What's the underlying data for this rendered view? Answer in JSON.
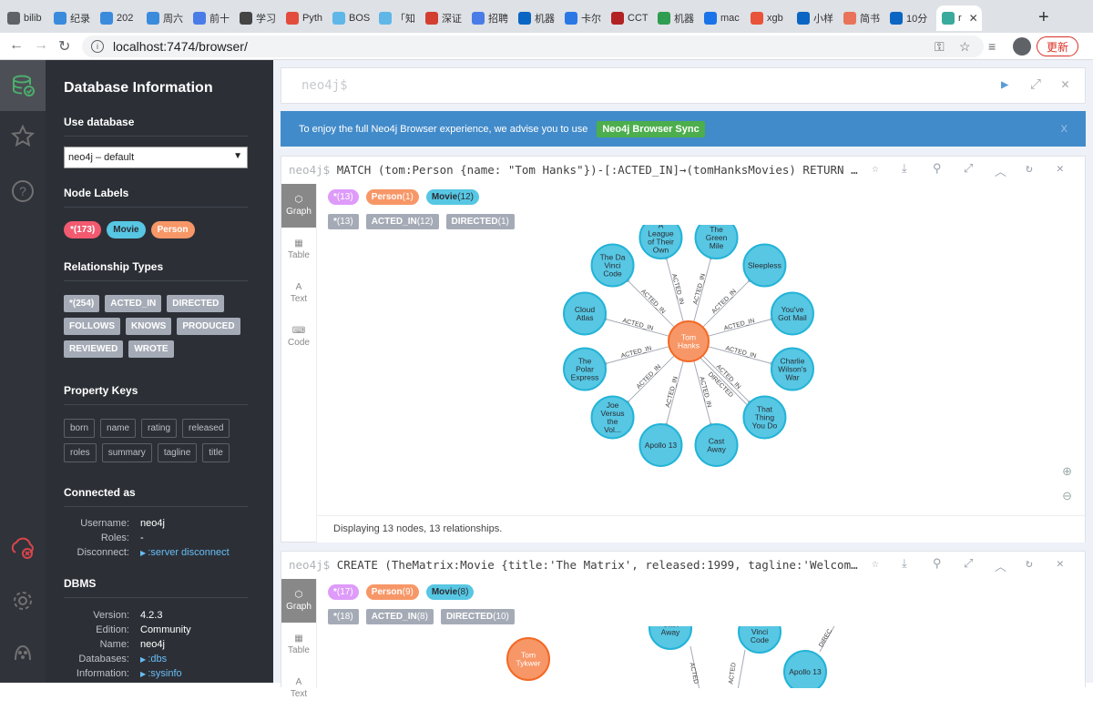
{
  "browser": {
    "tabs": [
      {
        "label": "bilib",
        "color": "#5f6368"
      },
      {
        "label": "纪录",
        "color": "#3b8bdc"
      },
      {
        "label": "202",
        "color": "#3b8bdc"
      },
      {
        "label": "周六",
        "color": "#3b8bdc"
      },
      {
        "label": "前十",
        "color": "#4a7ce8"
      },
      {
        "label": "学习",
        "color": "#444444"
      },
      {
        "label": "Pyth",
        "color": "#e34c3c"
      },
      {
        "label": "BOS",
        "color": "#5fb7e8"
      },
      {
        "label": "「知",
        "color": "#5fb7e8"
      },
      {
        "label": "深证",
        "color": "#d23f31"
      },
      {
        "label": "招聘",
        "color": "#4a7ce8"
      },
      {
        "label": "机器",
        "color": "#0a66c2"
      },
      {
        "label": "卡尔",
        "color": "#2b78e4"
      },
      {
        "label": "CCT",
        "color": "#b22222"
      },
      {
        "label": "机器",
        "color": "#2e9d4f"
      },
      {
        "label": "mac",
        "color": "#1a73e8"
      },
      {
        "label": "xgb",
        "color": "#e8533a"
      },
      {
        "label": "小样",
        "color": "#0a66c2"
      },
      {
        "label": "简书",
        "color": "#e9735a"
      },
      {
        "label": "10分",
        "color": "#0a66c2"
      },
      {
        "label": "r",
        "color": "#3aaa9c"
      }
    ],
    "url": "localhost:7474/browser/",
    "update_label": "更新"
  },
  "sidebar": {
    "title": "Database Information",
    "use_database_heading": "Use database",
    "selected_database": "neo4j – default",
    "node_labels_heading": "Node Labels",
    "node_labels": [
      {
        "label": "*(173)",
        "color": "#f25a70"
      },
      {
        "label": "Movie",
        "color": "#57c7e3"
      },
      {
        "label": "Person",
        "color": "#f79767"
      }
    ],
    "relationship_types_heading": "Relationship Types",
    "relationship_types": [
      "*(254)",
      "ACTED_IN",
      "DIRECTED",
      "FOLLOWS",
      "KNOWS",
      "PRODUCED",
      "REVIEWED",
      "WROTE"
    ],
    "property_keys_heading": "Property Keys",
    "property_keys": [
      "born",
      "name",
      "rating",
      "released",
      "roles",
      "summary",
      "tagline",
      "title"
    ],
    "connected_heading": "Connected as",
    "username_label": "Username:",
    "username": "neo4j",
    "roles_label": "Roles:",
    "roles": "-",
    "disconnect_label": "Disconnect:",
    "disconnect_link": ":server disconnect",
    "dbms_heading": "DBMS",
    "version_label": "Version:",
    "version": "4.2.3",
    "edition_label": "Edition:",
    "edition": "Community",
    "name_label": "Name:",
    "name": "neo4j",
    "databases_label": "Databases:",
    "databases_link": ":dbs",
    "information_label": "Information:",
    "information_link": ":sysinfo"
  },
  "editor": {
    "placeholder": "neo4j$"
  },
  "banner": {
    "text": "To enjoy the full Neo4j Browser experience, we advise you to use",
    "sync_label": "Neo4j Browser Sync",
    "close": "X"
  },
  "frames": [
    {
      "prompt": "neo4j$",
      "query": "MATCH (tom:Person {name: \"Tom Hanks\"})-[:ACTED_IN]→(tomHanksMovies) RETURN tom,tomHanksMovies",
      "views": [
        "Graph",
        "Table",
        "Text",
        "Code"
      ],
      "node_legend": [
        {
          "name": "*",
          "count": "(13)",
          "bg": "#de9bf9",
          "fg": "#ffffff"
        },
        {
          "name": "Person",
          "count": "(1)",
          "bg": "#f79767",
          "fg": "#ffffff"
        },
        {
          "name": "Movie",
          "count": "(12)",
          "bg": "#57c7e3",
          "fg": "#2a2c34"
        }
      ],
      "rel_legend": [
        {
          "name": "*",
          "count": "(13)"
        },
        {
          "name": "ACTED_IN",
          "count": "(12)"
        },
        {
          "name": "DIRECTED",
          "count": "(1)"
        }
      ],
      "center": {
        "label": "Tom Hanks",
        "lines": [
          "Tom",
          "Hanks"
        ]
      },
      "movies": [
        {
          "lines": [
            "A",
            "League",
            "of Their",
            "Own"
          ],
          "rel": "ACTED_IN"
        },
        {
          "lines": [
            "The",
            "Green",
            "Mile"
          ],
          "rel": "ACTED_IN"
        },
        {
          "lines": [
            "Sleepless"
          ],
          "rel": "ACTED_IN"
        },
        {
          "lines": [
            "You've",
            "Got Mail"
          ],
          "rel": "ACTED_IN"
        },
        {
          "lines": [
            "Charlie",
            "Wilson's",
            "War"
          ],
          "rel": "ACTED_IN"
        },
        {
          "lines": [
            "That",
            "Thing",
            "You Do"
          ],
          "rel": "ACTED_IN"
        },
        {
          "lines": [
            "Cast",
            "Away"
          ],
          "rel": "ACTED_IN"
        },
        {
          "lines": [
            "Apollo 13"
          ],
          "rel": "ACTED_IN"
        },
        {
          "lines": [
            "Joe",
            "Versus",
            "the",
            "Vol..."
          ],
          "rel": "ACTED_IN"
        },
        {
          "lines": [
            "The",
            "Polar",
            "Express"
          ],
          "rel": "ACTED_IN"
        },
        {
          "lines": [
            "Cloud",
            "Atlas"
          ],
          "rel": "ACTED_IN"
        },
        {
          "lines": [
            "The Da",
            "Vinci",
            "Code"
          ],
          "rel": "ACTED_IN"
        }
      ],
      "extra_rel": "DIRECTED",
      "status": "Displaying 13 nodes, 13 relationships."
    },
    {
      "prompt": "neo4j$",
      "query": "CREATE (TheMatrix:Movie {title:'The Matrix', released:1999, tagline:'Welcome to the Real World'})",
      "views": [
        "Graph",
        "Table",
        "Text"
      ],
      "node_legend": [
        {
          "name": "*",
          "count": "(17)",
          "bg": "#de9bf9",
          "fg": "#ffffff"
        },
        {
          "name": "Person",
          "count": "(9)",
          "bg": "#f79767",
          "fg": "#ffffff"
        },
        {
          "name": "Movie",
          "count": "(8)",
          "bg": "#57c7e3",
          "fg": "#2a2c34"
        }
      ],
      "rel_legend": [
        {
          "name": "*",
          "count": "(18)"
        },
        {
          "name": "ACTED_IN",
          "count": "(8)"
        },
        {
          "name": "DIRECTED",
          "count": "(10)"
        }
      ],
      "nodes": [
        {
          "lines": [
            "Tom",
            "Tykwer"
          ]
        },
        {
          "lines": [
            "Cast",
            "Away"
          ]
        },
        {
          "lines": [
            "The Da",
            "Vinci",
            "Code"
          ]
        },
        {
          "lines": [
            "Apollo 13"
          ]
        }
      ],
      "edge_labels": [
        "ACTED",
        "ACTED",
        "DIREC"
      ]
    }
  ]
}
